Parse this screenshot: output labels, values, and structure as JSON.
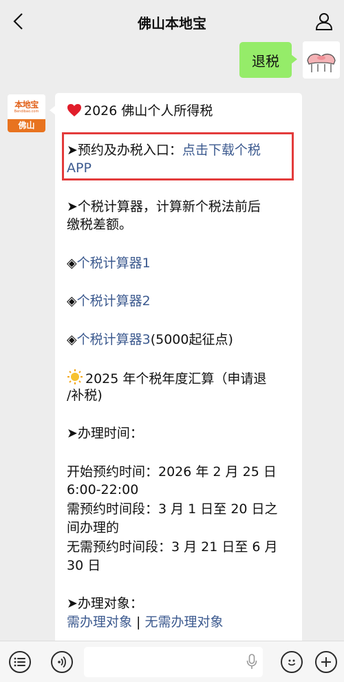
{
  "header": {
    "title": "佛山本地宝"
  },
  "outgoing": {
    "text": "退税"
  },
  "bot": {
    "logo_text": "本地宝",
    "logo_sub": "Bendibao.com",
    "logo_city": "佛山"
  },
  "message": {
    "line1": "2026 佛山个人所得税",
    "line2_prefix": "➤预约及办税入口：",
    "line2_link": "点击下载个税",
    "line3_link": "APP",
    "line4": "➤个税计算器，计算新个税法前后",
    "line5": "缴税差额。",
    "calc1_prefix": "◈",
    "calc1_link": "个税计算器1",
    "calc2_prefix": "◈",
    "calc2_link": "个税计算器2",
    "calc3_prefix": "◈",
    "calc3_link": "个税计算器3",
    "calc3_suffix": "(5000起征点)",
    "annual1": "2025 年个税年度汇算（申请退",
    "annual2": "/补税)",
    "time_title": "➤办理时间：",
    "time1": "开始预约时间：2026 年 2 月 25 日",
    "time2": "6:00-22:00",
    "time3": "需预约时间段：3 月 1 日至 20 日之",
    "time4": "间办理的",
    "time5": "无需预约时间段：3 月 21 日至 6 月",
    "time6": "30 日",
    "target_title": "➤办理对象：",
    "target_link1": "需办理对象",
    "target_sep": " | ",
    "target_link2": "无需办理对象"
  },
  "colors": {
    "bubble_green": "#95ec69",
    "link_blue": "#3c5a8f",
    "highlight_red": "#e33b3b",
    "brand_orange": "#e8731f"
  }
}
